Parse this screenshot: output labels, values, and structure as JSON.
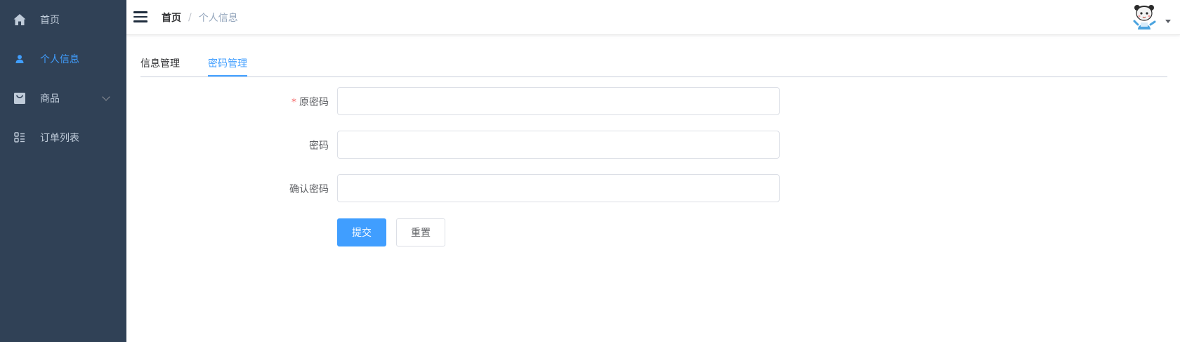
{
  "sidebar": {
    "items": [
      {
        "label": "首页",
        "icon": "home-icon"
      },
      {
        "label": "个人信息",
        "icon": "user-icon",
        "active": true
      },
      {
        "label": "商品",
        "icon": "shopping-bag-icon",
        "has_submenu": true
      },
      {
        "label": "订单列表",
        "icon": "list-icon"
      }
    ],
    "background": "#304156",
    "text_color": "#bfcbd9",
    "active_color": "#409eff"
  },
  "navbar": {
    "breadcrumb": {
      "home": "首页",
      "separator": "/",
      "current": "个人信息"
    }
  },
  "tabs": [
    {
      "label": "信息管理",
      "active": false
    },
    {
      "label": "密码管理",
      "active": true
    }
  ],
  "form": {
    "fields": [
      {
        "label": "原密码",
        "required": true,
        "value": "",
        "placeholder": ""
      },
      {
        "label": "密码",
        "required": false,
        "value": "",
        "placeholder": ""
      },
      {
        "label": "确认密码",
        "required": false,
        "value": "",
        "placeholder": ""
      }
    ],
    "submit_label": "提交",
    "reset_label": "重置"
  },
  "colors": {
    "accent": "#409eff",
    "required": "#f56c6c"
  }
}
